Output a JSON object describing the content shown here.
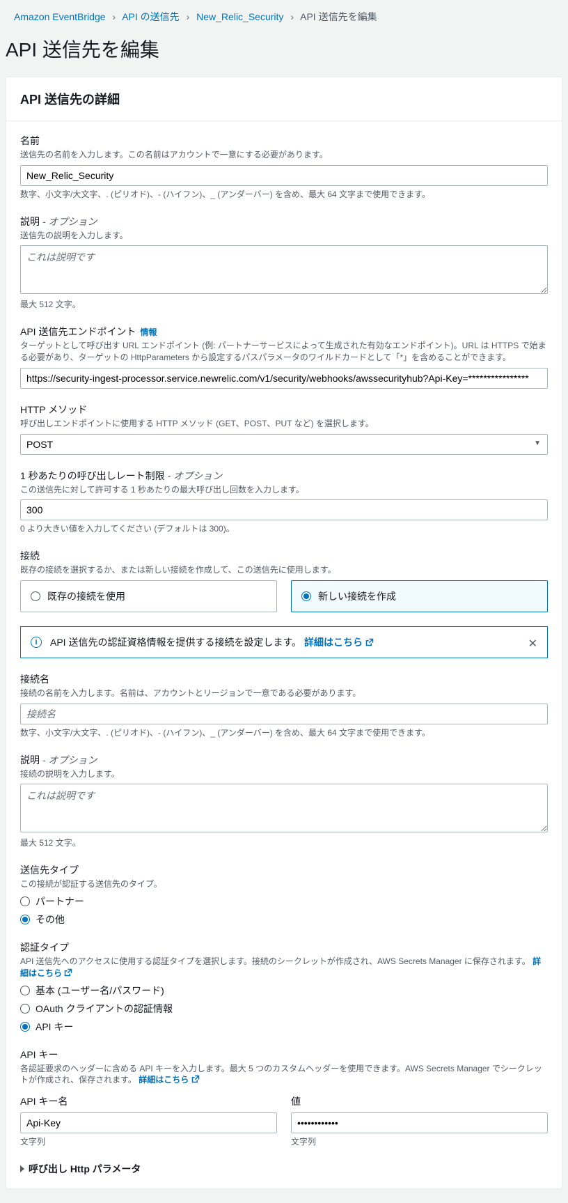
{
  "breadcrumb": {
    "items": [
      "Amazon EventBridge",
      "API の送信先",
      "New_Relic_Security"
    ],
    "current": "API 送信先を編集"
  },
  "page_title": "API 送信先を編集",
  "panel": {
    "title": "API 送信先の詳細"
  },
  "name": {
    "label": "名前",
    "desc": "送信先の名前を入力します。この名前はアカウントで一意にする必要があります。",
    "value": "New_Relic_Security",
    "hint": "数字、小文字/大文字、. (ピリオド)、- (ハイフン)、_ (アンダーバー) を含め、最大 64 文字まで使用できます。"
  },
  "desc1": {
    "label": "説明",
    "optional": "- オプション",
    "desc": "送信先の説明を入力します。",
    "placeholder": "これは説明です",
    "hint": "最大 512 文字。"
  },
  "endpoint": {
    "label": "API 送信先エンドポイント",
    "info": "情報",
    "desc": "ターゲットとして呼び出す URL エンドポイント (例: パートナーサービスによって生成された有効なエンドポイント)。URL は HTTPS で始まる必要があり、ターゲットの HttpParameters から設定するパスパラメータのワイルドカードとして「*」を含めることができます。",
    "value": "https://security-ingest-processor.service.newrelic.com/v1/security/webhooks/awssecurityhub?Api-Key=****************"
  },
  "method": {
    "label": "HTTP メソッド",
    "desc": "呼び出しエンドポイントに使用する HTTP メソッド (GET、POST、PUT など) を選択します。",
    "value": "POST"
  },
  "rate": {
    "label": "1 秒あたりの呼び出しレート制限",
    "optional": "- オプション",
    "desc": "この送信先に対して許可する 1 秒あたりの最大呼び出し回数を入力します。",
    "value": "300",
    "hint": "0 より大きい値を入力してください (デフォルトは 300)。"
  },
  "conn": {
    "label": "接続",
    "desc": "既存の接続を選択するか、または新しい接続を作成して、この送信先に使用します。",
    "opt_existing": "既存の接続を使用",
    "opt_new": "新しい接続を作成"
  },
  "alert": {
    "text": "API 送信先の認証資格情報を提供する接続を設定します。",
    "link": "詳細はこちら"
  },
  "conn_name": {
    "label": "接続名",
    "desc": "接続の名前を入力します。名前は、アカウントとリージョンで一意である必要があります。",
    "placeholder": "接続名",
    "hint": "数字、小文字/大文字、. (ピリオド)、- (ハイフン)、_ (アンダーバー) を含め、最大 64 文字まで使用できます。"
  },
  "desc2": {
    "label": "説明",
    "optional": "- オプション",
    "desc": "接続の説明を入力します。",
    "placeholder": "これは説明です",
    "hint": "最大 512 文字。"
  },
  "dest_type": {
    "label": "送信先タイプ",
    "desc": "この接続が認証する送信先のタイプ。",
    "opt_partner": "パートナー",
    "opt_other": "その他"
  },
  "auth_type": {
    "label": "認証タイプ",
    "desc": "API 送信先へのアクセスに使用する認証タイプを選択します。接続のシークレットが作成され、AWS Secrets Manager に保存されます。",
    "link": "詳細はこちら",
    "opt_basic": "基本 (ユーザー名/パスワード)",
    "opt_oauth": "OAuth クライアントの認証情報",
    "opt_apikey": "API キー"
  },
  "apikey": {
    "label": "API キー",
    "desc": "各認証要求のヘッダーに含める API キーを入力します。最大 5 つのカスタムヘッダーを使用できます。AWS Secrets Manager でシークレットが作成され、保存されます。",
    "link": "詳細はこちら",
    "name_label": "API キー名",
    "name_value": "Api-Key",
    "name_hint": "文字列",
    "value_label": "値",
    "value_value": "••••••••••••",
    "value_hint": "文字列"
  },
  "expand": "呼び出し Http パラメータ"
}
